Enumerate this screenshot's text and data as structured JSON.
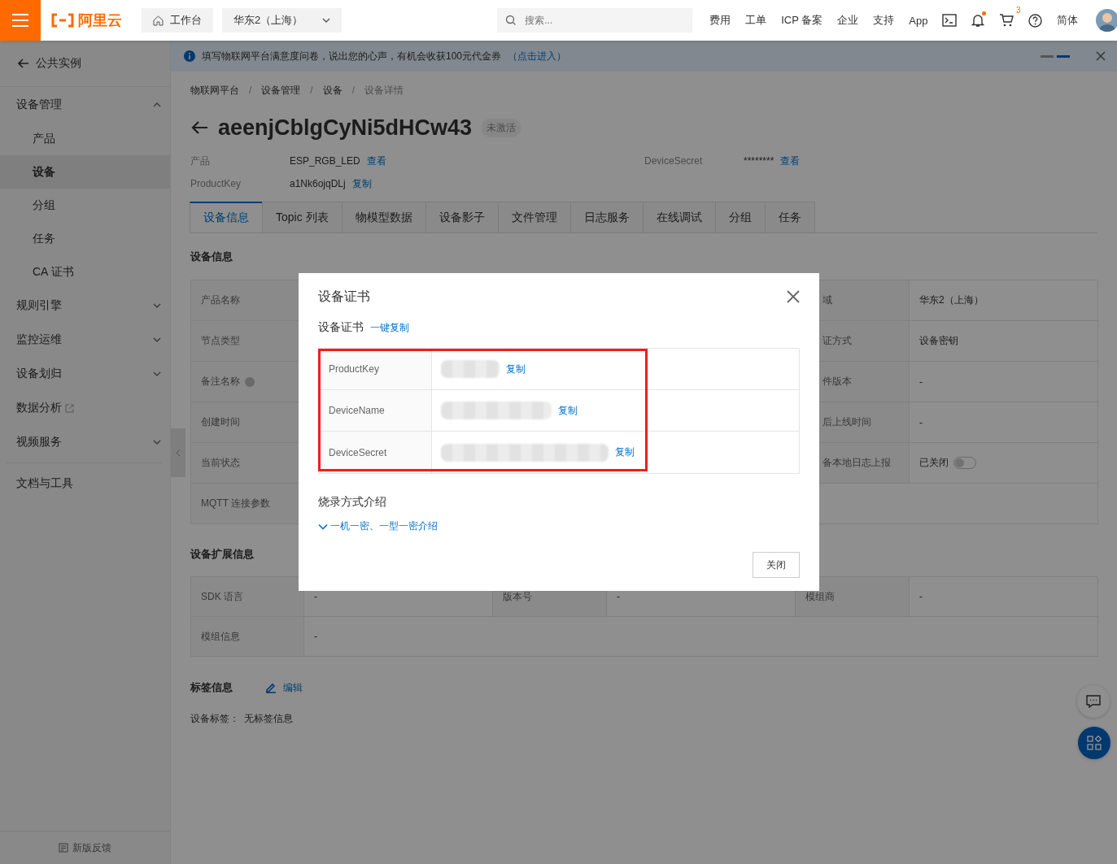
{
  "header": {
    "logo": "阿里云",
    "workbench": "工作台",
    "region": "华东2（上海）",
    "search": {
      "placeholder": "搜索..."
    },
    "links": [
      "费用",
      "工单",
      "ICP 备案",
      "企业",
      "支持",
      "App"
    ],
    "cart_count": "3",
    "language": "简体"
  },
  "notice": {
    "text": "填写物联网平台满意度问卷，说出您的心声，有机会收获100元代金券",
    "link": "（点击进入）"
  },
  "sidebar": {
    "back": "公共实例",
    "items": [
      {
        "kind": "group",
        "label": "设备管理",
        "expanded": true,
        "children": [
          {
            "label": "产品",
            "selected": false
          },
          {
            "label": "设备",
            "selected": true
          },
          {
            "label": "分组",
            "selected": false
          },
          {
            "label": "任务",
            "selected": false
          },
          {
            "label": "CA 证书",
            "selected": false
          }
        ]
      },
      {
        "kind": "group",
        "label": "规则引擎",
        "expanded": false
      },
      {
        "kind": "group",
        "label": "监控运维",
        "expanded": false
      },
      {
        "kind": "group",
        "label": "设备划归",
        "expanded": false
      },
      {
        "kind": "external",
        "label": "数据分析"
      },
      {
        "kind": "group",
        "label": "视频服务",
        "expanded": false
      }
    ],
    "docs": "文档与工具",
    "feedback": "新版反馈"
  },
  "breadcrumb": [
    "物联网平台",
    "设备管理",
    "设备",
    "设备详情"
  ],
  "breadcrumb_separator": "/",
  "device": {
    "name": "aeenjCblgCyNi5dHCw43",
    "status": "未激活",
    "fields": [
      {
        "label": "产品",
        "value": "ESP_RGB_LED",
        "action": "查看"
      },
      {
        "label": "ProductKey",
        "value": "a1Nk6ojqDLj",
        "action": "复制"
      },
      {
        "label": "DeviceSecret",
        "value": "********",
        "action": "查看"
      }
    ]
  },
  "tabs": [
    {
      "label": "设备信息",
      "selected": true
    },
    {
      "label": "Topic 列表",
      "selected": false
    },
    {
      "label": "物模型数据",
      "selected": false
    },
    {
      "label": "设备影子",
      "selected": false
    },
    {
      "label": "文件管理",
      "selected": false
    },
    {
      "label": "日志服务",
      "selected": false
    },
    {
      "label": "在线调试",
      "selected": false
    },
    {
      "label": "分组",
      "selected": false
    },
    {
      "label": "任务",
      "selected": false
    }
  ],
  "info": {
    "title": "设备信息",
    "rows": [
      {
        "label": "产品名称",
        "help": false,
        "column_3": "域",
        "column_4": "华东2（上海）"
      },
      {
        "label": "节点类型",
        "help": false,
        "column_3": "证方式",
        "column_4": "设备密钥"
      },
      {
        "label": "备注名称",
        "help": true,
        "column_3": "件版本",
        "column_4": "-"
      },
      {
        "label": "创建时间",
        "help": false,
        "column_3": "后上线时间",
        "column_4": "-"
      },
      {
        "label": "当前状态",
        "help": false,
        "column_3": "备本地日志上报",
        "column_4": "已关闭",
        "switch": {
          "on": false
        }
      },
      {
        "label": "MQTT 连接参数",
        "help": false
      }
    ]
  },
  "ext": {
    "title": "设备扩展信息",
    "rows": [
      [
        {
          "label": "SDK 语言",
          "value": "-"
        },
        {
          "label": "版本号",
          "value": "-"
        },
        {
          "label": "模组商",
          "value": "-"
        }
      ],
      [
        {
          "label": "模组信息",
          "value": "-"
        }
      ]
    ]
  },
  "tags": {
    "title": "标签信息",
    "edit": "编辑",
    "label": "设备标签：",
    "value": "无标签信息"
  },
  "dialog": {
    "title": "设备证书",
    "subtitle": "设备证书",
    "copy_all": "一键复制",
    "rows": [
      {
        "label": "ProductKey",
        "action": "复制"
      },
      {
        "label": "DeviceName",
        "action": "复制"
      },
      {
        "label": "DeviceSecret",
        "action": "复制"
      }
    ],
    "burn_title": "烧录方式介绍",
    "burn_link": "一机一密、一型一密介绍",
    "close": "关闭"
  }
}
